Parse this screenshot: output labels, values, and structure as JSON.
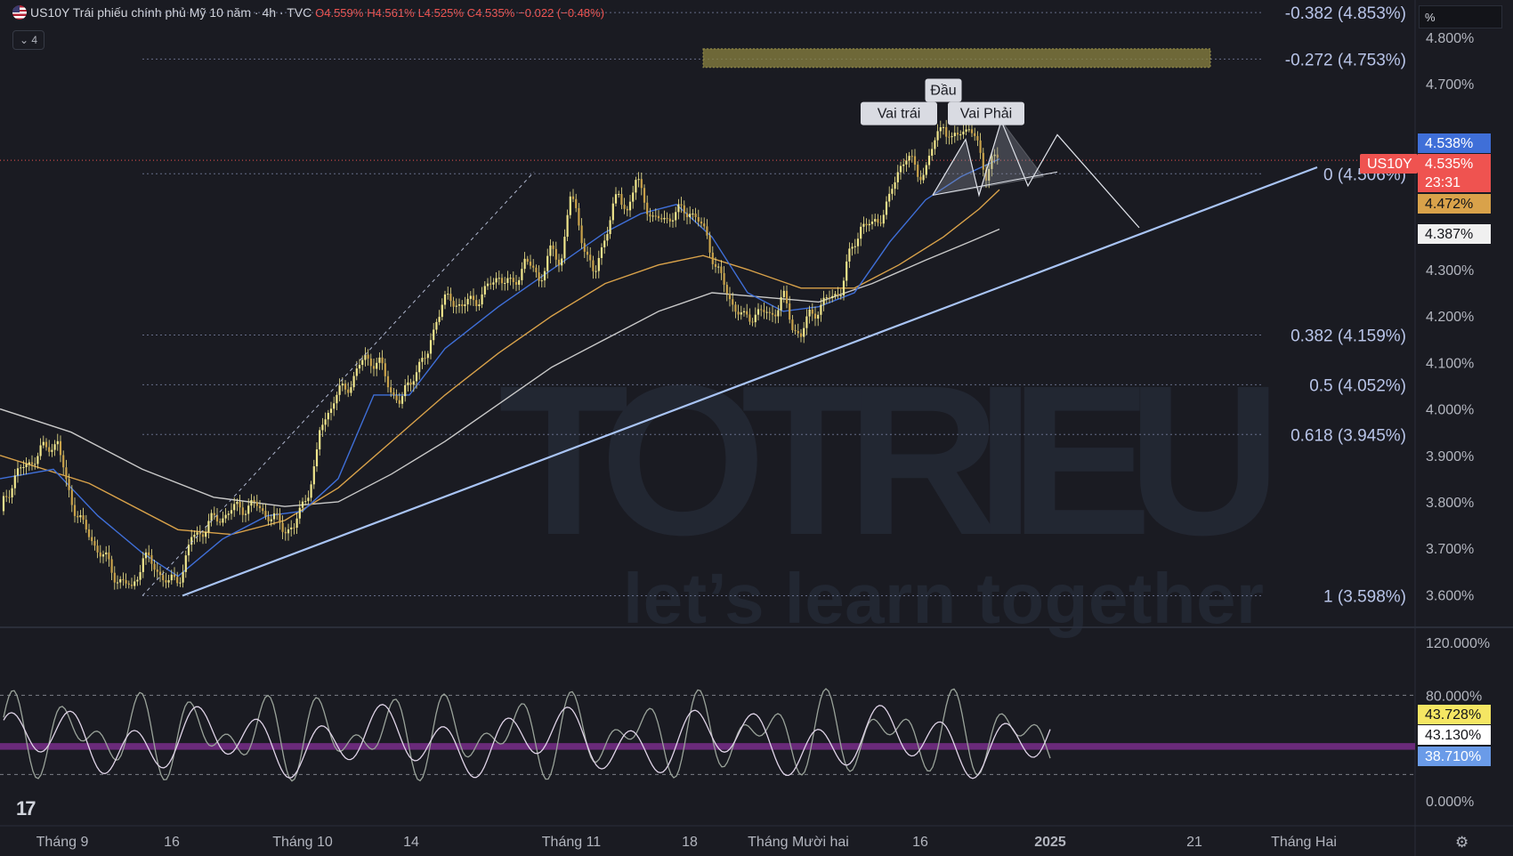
{
  "header": {
    "symbol": "US10Y",
    "title": "Trái phiếu chính phủ Mỹ 10 năm · 4h · TVC",
    "ohlc": {
      "open": "O4.559%",
      "high": "H4.561%",
      "low": "L4.525%",
      "close": "C4.535%",
      "change": "−0.022 (−0.48%)"
    },
    "indicator_count": "4",
    "unit": "%"
  },
  "watermark": {
    "brand": "TOTRIEU",
    "slogan": "let’s learn together"
  },
  "icons": {
    "collapse": "chevron-down-icon",
    "logo": "tradingview-logo-icon",
    "settings": "gear-icon",
    "flag": "us-flag-icon"
  },
  "colors": {
    "background": "#1a1b22",
    "candle": "#f0e68c",
    "trendline": "#a9c4f5",
    "ma_short": "#3f6fd8",
    "ma_mid": "#d9a24a",
    "ma_long": "#c9c9c9",
    "rsi_band": "#6a2a7a",
    "rsi_line": "#e0d4e8",
    "rsi_signal": "#9aa39a",
    "current_price": "#ef5350",
    "zone": "#8a8240"
  },
  "chart_data": [
    {
      "type": "candlestick",
      "title": "US10Y",
      "ylabel": "%",
      "ylim": [
        3.53,
        4.88
      ],
      "y_axis_ticks": [
        "4.800%",
        "4.700%",
        "4.300%",
        "4.200%",
        "4.100%",
        "4.000%",
        "3.900%",
        "3.800%",
        "3.700%",
        "3.600%"
      ],
      "x_axis_ticks": [
        "Tháng 9",
        "16",
        "Tháng 10",
        "14",
        "Tháng 11",
        "18",
        "Tháng Mười hai",
        "16",
        "2025",
        "21",
        "Tháng Hai"
      ],
      "price_path": [
        [
          0,
          3.78
        ],
        [
          15,
          3.85
        ],
        [
          35,
          3.89
        ],
        [
          55,
          3.92
        ],
        [
          65,
          3.93
        ],
        [
          75,
          3.83
        ],
        [
          95,
          3.74
        ],
        [
          110,
          3.7
        ],
        [
          130,
          3.64
        ],
        [
          148,
          3.61
        ],
        [
          160,
          3.68
        ],
        [
          175,
          3.66
        ],
        [
          190,
          3.62
        ],
        [
          205,
          3.65
        ],
        [
          215,
          3.72
        ],
        [
          240,
          3.76
        ],
        [
          270,
          3.79
        ],
        [
          290,
          3.79
        ],
        [
          315,
          3.75
        ],
        [
          330,
          3.74
        ],
        [
          345,
          3.82
        ],
        [
          355,
          3.88
        ],
        [
          360,
          3.96
        ],
        [
          375,
          4.02
        ],
        [
          395,
          4.06
        ],
        [
          410,
          4.11
        ],
        [
          425,
          4.1
        ],
        [
          440,
          4.04
        ],
        [
          450,
          4.01
        ],
        [
          465,
          4.08
        ],
        [
          480,
          4.11
        ],
        [
          490,
          4.2
        ],
        [
          505,
          4.24
        ],
        [
          520,
          4.22
        ],
        [
          545,
          4.25
        ],
        [
          560,
          4.29
        ],
        [
          575,
          4.26
        ],
        [
          590,
          4.32
        ],
        [
          605,
          4.28
        ],
        [
          620,
          4.34
        ],
        [
          630,
          4.31
        ],
        [
          640,
          4.46
        ],
        [
          650,
          4.4
        ],
        [
          660,
          4.33
        ],
        [
          668,
          4.28
        ],
        [
          680,
          4.38
        ],
        [
          695,
          4.46
        ],
        [
          705,
          4.43
        ],
        [
          715,
          4.49
        ],
        [
          725,
          4.45
        ],
        [
          735,
          4.4
        ],
        [
          745,
          4.41
        ],
        [
          760,
          4.42
        ],
        [
          775,
          4.43
        ],
        [
          785,
          4.4
        ],
        [
          795,
          4.37
        ],
        [
          805,
          4.3
        ],
        [
          820,
          4.24
        ],
        [
          835,
          4.19
        ],
        [
          850,
          4.21
        ],
        [
          865,
          4.2
        ],
        [
          880,
          4.24
        ],
        [
          890,
          4.18
        ],
        [
          900,
          4.16
        ],
        [
          910,
          4.2
        ],
        [
          920,
          4.22
        ],
        [
          935,
          4.24
        ],
        [
          945,
          4.26
        ],
        [
          955,
          4.33
        ],
        [
          968,
          4.4
        ],
        [
          980,
          4.39
        ],
        [
          990,
          4.42
        ],
        [
          1000,
          4.45
        ],
        [
          1010,
          4.52
        ],
        [
          1020,
          4.55
        ],
        [
          1030,
          4.5
        ],
        [
          1040,
          4.52
        ],
        [
          1052,
          4.58
        ],
        [
          1060,
          4.62
        ],
        [
          1070,
          4.57
        ],
        [
          1080,
          4.6
        ],
        [
          1090,
          4.61
        ],
        [
          1100,
          4.55
        ],
        [
          1108,
          4.51
        ],
        [
          1115,
          4.54
        ],
        [
          1123,
          4.535
        ]
      ],
      "ma_short_path": [
        [
          0,
          3.85
        ],
        [
          60,
          3.87
        ],
        [
          110,
          3.77
        ],
        [
          160,
          3.69
        ],
        [
          200,
          3.64
        ],
        [
          250,
          3.72
        ],
        [
          300,
          3.77
        ],
        [
          340,
          3.78
        ],
        [
          380,
          3.85
        ],
        [
          420,
          4.03
        ],
        [
          460,
          4.03
        ],
        [
          500,
          4.13
        ],
        [
          560,
          4.22
        ],
        [
          620,
          4.3
        ],
        [
          680,
          4.38
        ],
        [
          720,
          4.42
        ],
        [
          760,
          4.44
        ],
        [
          800,
          4.37
        ],
        [
          840,
          4.25
        ],
        [
          880,
          4.21
        ],
        [
          920,
          4.22
        ],
        [
          960,
          4.25
        ],
        [
          1000,
          4.36
        ],
        [
          1040,
          4.45
        ],
        [
          1080,
          4.5
        ],
        [
          1123,
          4.538
        ]
      ],
      "ma_mid_path": [
        [
          0,
          3.9
        ],
        [
          100,
          3.84
        ],
        [
          200,
          3.74
        ],
        [
          260,
          3.73
        ],
        [
          320,
          3.76
        ],
        [
          380,
          3.83
        ],
        [
          440,
          3.93
        ],
        [
          500,
          4.03
        ],
        [
          560,
          4.12
        ],
        [
          620,
          4.2
        ],
        [
          680,
          4.27
        ],
        [
          740,
          4.31
        ],
        [
          790,
          4.33
        ],
        [
          840,
          4.3
        ],
        [
          900,
          4.26
        ],
        [
          960,
          4.26
        ],
        [
          1010,
          4.31
        ],
        [
          1060,
          4.37
        ],
        [
          1100,
          4.43
        ],
        [
          1123,
          4.472
        ]
      ],
      "ma_long_path": [
        [
          0,
          4.0
        ],
        [
          80,
          3.95
        ],
        [
          160,
          3.87
        ],
        [
          240,
          3.81
        ],
        [
          320,
          3.79
        ],
        [
          380,
          3.8
        ],
        [
          440,
          3.86
        ],
        [
          500,
          3.93
        ],
        [
          560,
          4.01
        ],
        [
          620,
          4.09
        ],
        [
          680,
          4.15
        ],
        [
          740,
          4.21
        ],
        [
          800,
          4.25
        ],
        [
          860,
          4.24
        ],
        [
          920,
          4.23
        ],
        [
          980,
          4.27
        ],
        [
          1040,
          4.32
        ],
        [
          1090,
          4.36
        ],
        [
          1123,
          4.387
        ]
      ],
      "fibonacci_levels": [
        {
          "label": "-0.382 (4.853%)",
          "value": 4.853
        },
        {
          "label": "-0.272 (4.753%)",
          "value": 4.753
        },
        {
          "label": "0 (4.506%)",
          "value": 4.506
        },
        {
          "label": "0.382 (4.159%)",
          "value": 4.159
        },
        {
          "label": "0.5 (4.052%)",
          "value": 4.052
        },
        {
          "label": "0.618 (3.945%)",
          "value": 3.945
        },
        {
          "label": "1 (3.598%)",
          "value": 3.598
        }
      ],
      "price_labels": [
        {
          "text": "4.538%",
          "value": 4.538,
          "color": "#3f6fd8"
        },
        {
          "text": "US10Y",
          "value": 4.535,
          "color": "#ef5350"
        },
        {
          "text": "4.535%",
          "value": 4.535,
          "color": "#ef5350"
        },
        {
          "text": "23:31",
          "value": 4.535,
          "color": "#ef5350"
        },
        {
          "text": "4.472%",
          "value": 4.472,
          "color": "#d9a24a"
        },
        {
          "text": "4.387%",
          "value": 4.387,
          "color": "#f0f0f0"
        }
      ],
      "annotations": [
        {
          "text": "Vai trái",
          "x": 1010,
          "y": 4.58
        },
        {
          "text": "Đầu",
          "x": 1060,
          "y": 4.63
        },
        {
          "text": "Vai Phải",
          "x": 1108,
          "y": 4.58
        }
      ]
    },
    {
      "type": "line",
      "title": "RSI",
      "ylim": [
        0,
        120
      ],
      "y_axis_ticks": [
        "120.000%",
        "80.000%",
        "0.000%"
      ],
      "band": [
        38.71,
        43.728
      ],
      "series": [
        {
          "label_value": "43.728%",
          "color": "#f5e663",
          "dark_text": true
        },
        {
          "label_value": "43.130%",
          "color": "#ffffff",
          "dark_text": true
        },
        {
          "label_value": "38.710%",
          "color": "#6a9be8",
          "dark_text": false
        }
      ],
      "reference_lines": [
        80,
        20
      ]
    }
  ]
}
